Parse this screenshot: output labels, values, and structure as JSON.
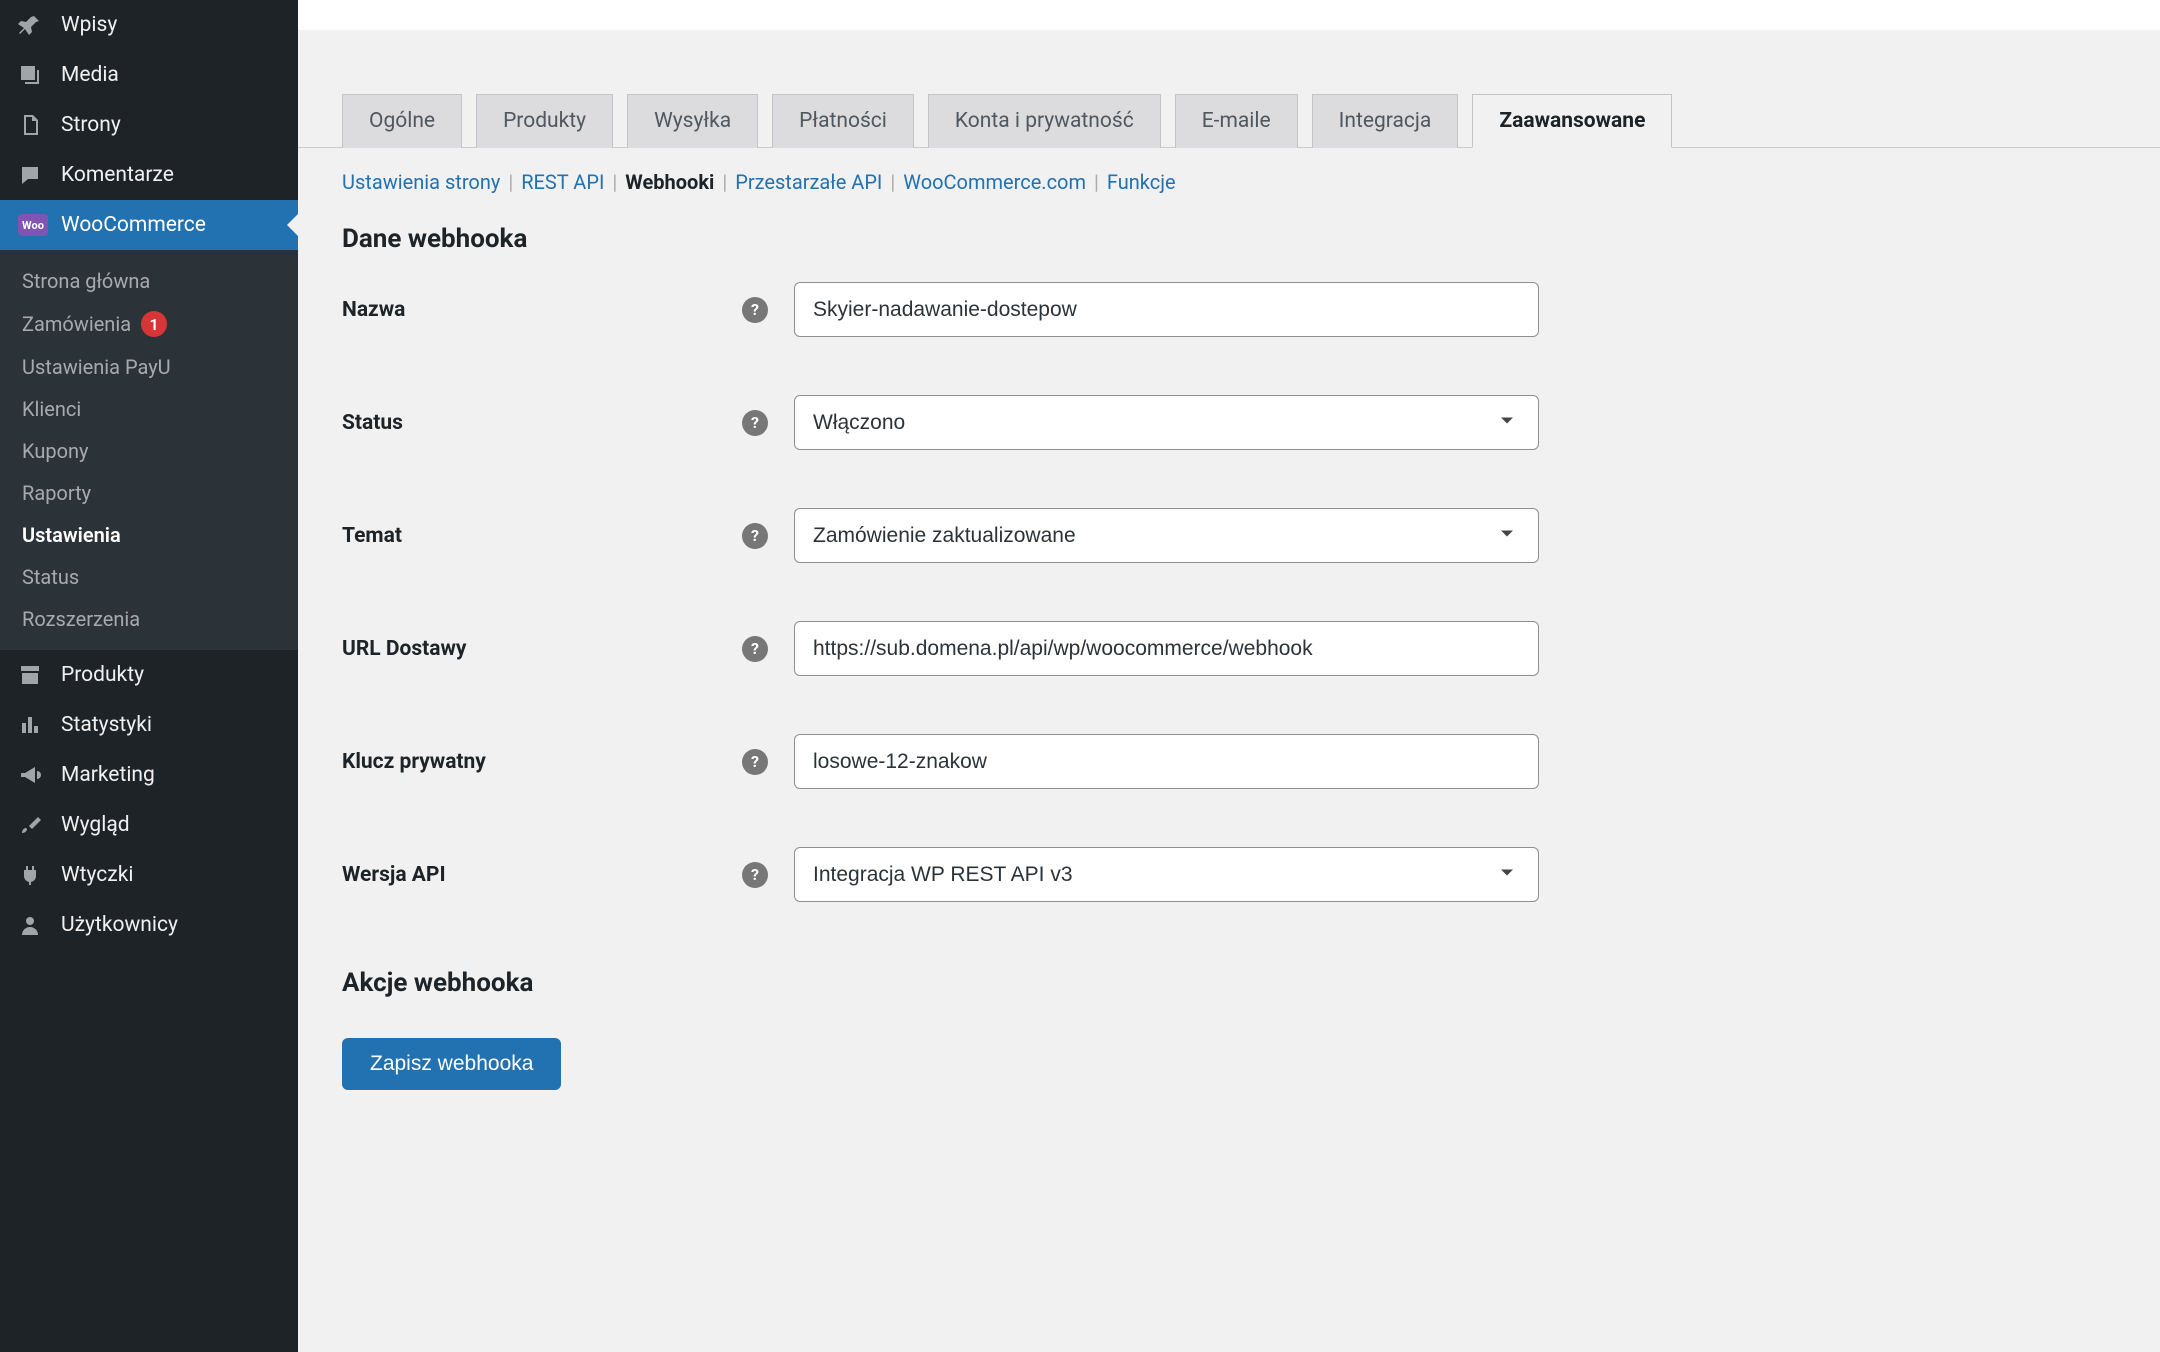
{
  "sidebar": {
    "items": [
      {
        "label": "Wpisy",
        "icon": "pin"
      },
      {
        "label": "Media",
        "icon": "media"
      },
      {
        "label": "Strony",
        "icon": "pages"
      },
      {
        "label": "Komentarze",
        "icon": "comment"
      },
      {
        "label": "WooCommerce",
        "icon": "woo",
        "active": true
      },
      {
        "label": "Produkty",
        "icon": "archive"
      },
      {
        "label": "Statystyki",
        "icon": "stats"
      },
      {
        "label": "Marketing",
        "icon": "megaphone"
      },
      {
        "label": "Wygląd",
        "icon": "brush"
      },
      {
        "label": "Wtyczki",
        "icon": "plug"
      },
      {
        "label": "Użytkownicy",
        "icon": "user"
      }
    ],
    "submenu": [
      {
        "label": "Strona główna"
      },
      {
        "label": "Zamówienia",
        "badge": "1"
      },
      {
        "label": "Ustawienia PayU"
      },
      {
        "label": "Klienci"
      },
      {
        "label": "Kupony"
      },
      {
        "label": "Raporty"
      },
      {
        "label": "Ustawienia",
        "current": true
      },
      {
        "label": "Status"
      },
      {
        "label": "Rozszerzenia"
      }
    ]
  },
  "tabs": [
    "Ogólne",
    "Produkty",
    "Wysyłka",
    "Płatności",
    "Konta i prywatność",
    "E-maile",
    "Integracja",
    "Zaawansowane"
  ],
  "active_tab": "Zaawansowane",
  "subtabs": [
    "Ustawienia strony",
    "REST API",
    "Webhooki",
    "Przestarzałe API",
    "WooCommerce.com",
    "Funkcje"
  ],
  "active_subtab": "Webhooki",
  "section1_title": "Dane webhooka",
  "section2_title": "Akcje webhooka",
  "form": {
    "name_label": "Nazwa",
    "name_value": "Skyier-nadawanie-dostepow",
    "status_label": "Status",
    "status_value": "Włączono",
    "topic_label": "Temat",
    "topic_value": "Zamówienie zaktualizowane",
    "url_label": "URL Dostawy",
    "url_value": "https://sub.domena.pl/api/wp/woocommerce/webhook",
    "secret_label": "Klucz prywatny",
    "secret_value": "losowe-12-znakow",
    "api_label": "Wersja API",
    "api_value": "Integracja WP REST API v3"
  },
  "save_button": "Zapisz webhooka"
}
